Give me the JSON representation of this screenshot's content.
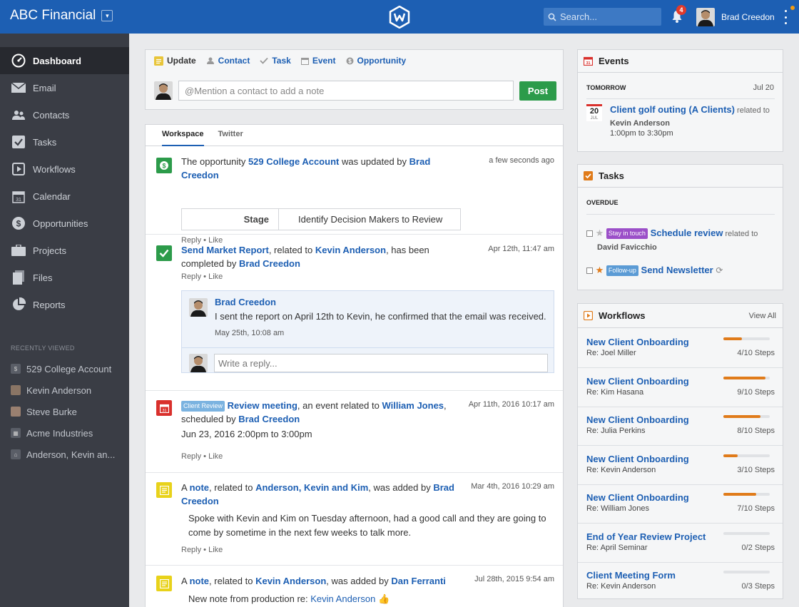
{
  "header": {
    "app_title": "ABC Financial",
    "search_placeholder": "Search...",
    "notification_count": "4",
    "user_name": "Brad Creedon"
  },
  "sidebar": {
    "items": [
      {
        "label": "Dashboard",
        "icon": "dashboard-icon"
      },
      {
        "label": "Email",
        "icon": "email-icon"
      },
      {
        "label": "Contacts",
        "icon": "contacts-icon"
      },
      {
        "label": "Tasks",
        "icon": "tasks-icon"
      },
      {
        "label": "Workflows",
        "icon": "workflows-icon"
      },
      {
        "label": "Calendar",
        "icon": "calendar-icon"
      },
      {
        "label": "Opportunities",
        "icon": "opportunities-icon"
      },
      {
        "label": "Projects",
        "icon": "projects-icon"
      },
      {
        "label": "Files",
        "icon": "files-icon"
      },
      {
        "label": "Reports",
        "icon": "reports-icon"
      }
    ],
    "recent_heading": "RECENTLY VIEWED",
    "recent": [
      "529 College Account",
      "Kevin Anderson",
      "Steve Burke",
      "Acme Industries",
      "Anderson, Kevin an..."
    ]
  },
  "update": {
    "tabs": [
      "Update",
      "Contact",
      "Task",
      "Event",
      "Opportunity"
    ],
    "placeholder": "@Mention a contact to add a note",
    "post_label": "Post"
  },
  "feed": {
    "tabs": [
      "Workspace",
      "Twitter"
    ],
    "reply": "Reply",
    "like": "Like",
    "item1": {
      "pre": "The opportunity ",
      "link1": "529 College Account",
      "mid": " was updated by ",
      "link2a": "Brad",
      "link2b": "Creedon",
      "time": "a few seconds ago",
      "stage_label": "Stage",
      "stage_value": "Identify Decision Makers to Review"
    },
    "item2": {
      "link1": "Send Market Report",
      "mid1": ", related to ",
      "link2": "Kevin Anderson",
      "mid2": ", has been",
      "pre3": "completed by ",
      "link3": "Brad Creedon",
      "time": "Apr 12th, 11:47 am",
      "comment_author": "Brad Creedon",
      "comment_text": "I sent the report on April 12th to Kevin, he confirmed that the email was received.",
      "comment_time": "May 25th, 10:08 am",
      "reply_placeholder": "Write a reply..."
    },
    "item3": {
      "tag": "Client Review",
      "link1": "Review meeting",
      "mid": ", an event related to ",
      "link2": "William Jones",
      "end": ",",
      "pre2": "scheduled by ",
      "link3": "Brad Creedon",
      "when": "Jun 23, 2016 2:00pm to 3:00pm",
      "time": "Apr 11th, 2016 10:17 am"
    },
    "item4": {
      "pre": "A ",
      "link1": "note",
      "mid": ", related to ",
      "link2": "Anderson, Kevin and Kim",
      "mid2": ", was added by ",
      "link3a": "Brad",
      "link3b": "Creedon",
      "body1": "Spoke with Kevin and Kim on Tuesday afternoon, had a good call and they are going to",
      "body2": "come by sometime in the next few weeks to talk more.",
      "time": "Mar 4th, 2016 10:29 am"
    },
    "item5": {
      "pre": "A ",
      "link1": "note",
      "mid": ", related to ",
      "link2": "Kevin Anderson",
      "mid2": ", was added by ",
      "link3": "Dan Ferranti",
      "body_pre": "New note from production re: ",
      "body_link": "Kevin Anderson",
      "time": "Jul 28th, 2015 9:54 am"
    }
  },
  "events": {
    "title": "Events",
    "day_label": "TOMORROW",
    "date": "Jul 20",
    "cal_day": "20",
    "cal_month": "JUL",
    "event_title": "Client golf outing (A Clients)",
    "related": " related to",
    "contact": "Kevin Anderson",
    "time_range": "1:00pm to 3:30pm"
  },
  "tasks": {
    "title": "Tasks",
    "overdue_label": "OVERDUE",
    "items": [
      {
        "tag": "Stay in touch",
        "tag_color": "#9b4fc8",
        "title": "Schedule review",
        "related": " related to",
        "contact": "David Favicchio"
      },
      {
        "tag": "Follow-up",
        "tag_color": "#5b9bd5",
        "title": "Send Newsletter",
        "related": "",
        "contact": ""
      }
    ]
  },
  "workflows": {
    "title": "Workflows",
    "view_all": "View All",
    "items": [
      {
        "name": "New Client Onboarding",
        "re": "Re: Joel Miller",
        "steps": "4/10 Steps",
        "progress": 0.4
      },
      {
        "name": "New Client Onboarding",
        "re": "Re: Kim Hasana",
        "steps": "9/10 Steps",
        "progress": 0.9
      },
      {
        "name": "New Client Onboarding",
        "re": "Re: Julia Perkins",
        "steps": "8/10 Steps",
        "progress": 0.8
      },
      {
        "name": "New Client Onboarding",
        "re": "Re: Kevin Anderson",
        "steps": "3/10 Steps",
        "progress": 0.3
      },
      {
        "name": "New Client Onboarding",
        "re": "Re: William Jones",
        "steps": "7/10 Steps",
        "progress": 0.7
      },
      {
        "name": "End of Year Review Project",
        "re": "Re: April Seminar",
        "steps": "0/2 Steps",
        "progress": 0
      },
      {
        "name": "Client Meeting Form",
        "re": "Re: Kevin Anderson",
        "steps": "0/3 Steps",
        "progress": 0
      }
    ]
  },
  "colors": {
    "brand": "#1d5fb3",
    "sidebar": "#3a3d45",
    "post": "#2c9b4a",
    "progress": "#e07b1a"
  }
}
